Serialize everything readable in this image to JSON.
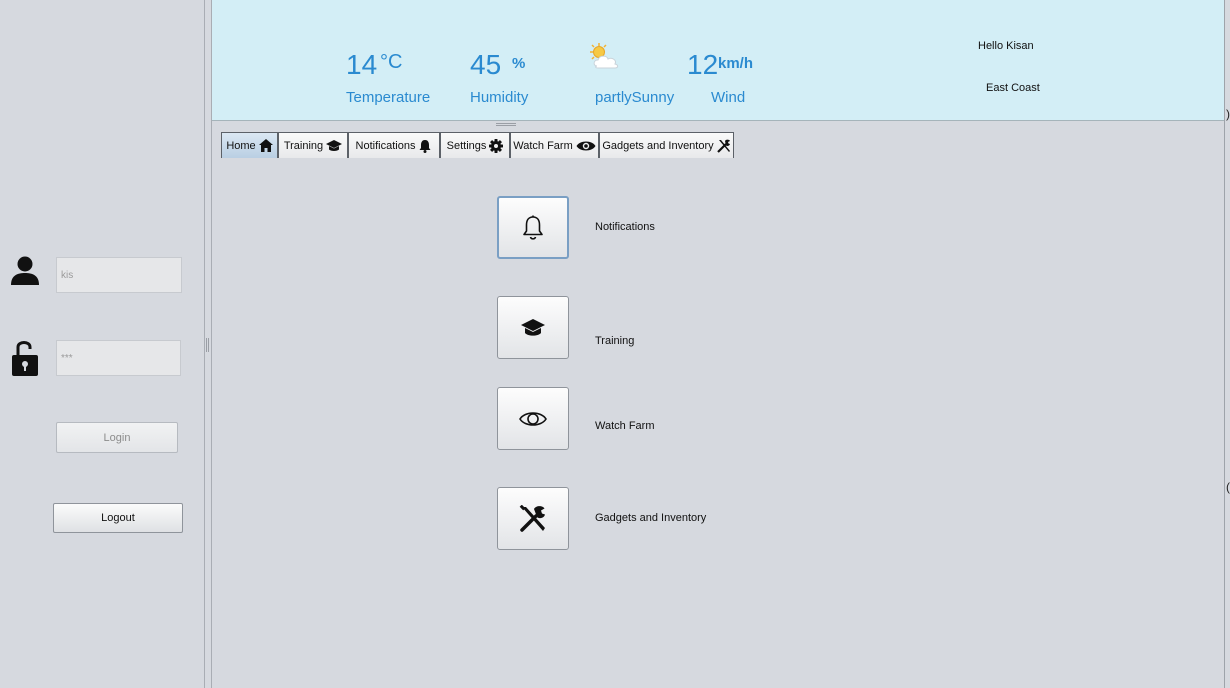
{
  "login": {
    "username_value": "kis",
    "password_value": "***",
    "login_label": "Login",
    "logout_label": "Logout"
  },
  "weather": {
    "temperature_value": "14",
    "temperature_unit": "°C",
    "temperature_label": "Temperature",
    "humidity_value": "45",
    "humidity_unit": "%",
    "humidity_label": "Humidity",
    "condition_label": "partlySunny",
    "wind_value": "12",
    "wind_unit": "km/h",
    "wind_label": "Wind",
    "accent_color": "#2a8ad0"
  },
  "header": {
    "greeting": "Hello Kisan",
    "location": "East Coast"
  },
  "tabs": [
    {
      "label": "Home",
      "icon": "home-icon",
      "active": true
    },
    {
      "label": "Training",
      "icon": "graduation-cap-icon",
      "active": false
    },
    {
      "label": "Notifications",
      "icon": "bell-icon",
      "active": false
    },
    {
      "label": "Settings",
      "icon": "gear-icon",
      "active": false
    },
    {
      "label": "Watch Farm",
      "icon": "eye-icon",
      "active": false
    },
    {
      "label": "Gadgets and Inventory",
      "icon": "tools-icon",
      "active": false
    }
  ],
  "home": {
    "items": [
      {
        "label": "Notifications",
        "icon": "bell-outline-icon"
      },
      {
        "label": "Training",
        "icon": "graduation-cap-icon"
      },
      {
        "label": "Watch Farm",
        "icon": "eye-outline-icon"
      },
      {
        "label": "Gadgets and Inventory",
        "icon": "tools-icon"
      }
    ]
  },
  "edge_marks": [
    ")",
    "("
  ]
}
